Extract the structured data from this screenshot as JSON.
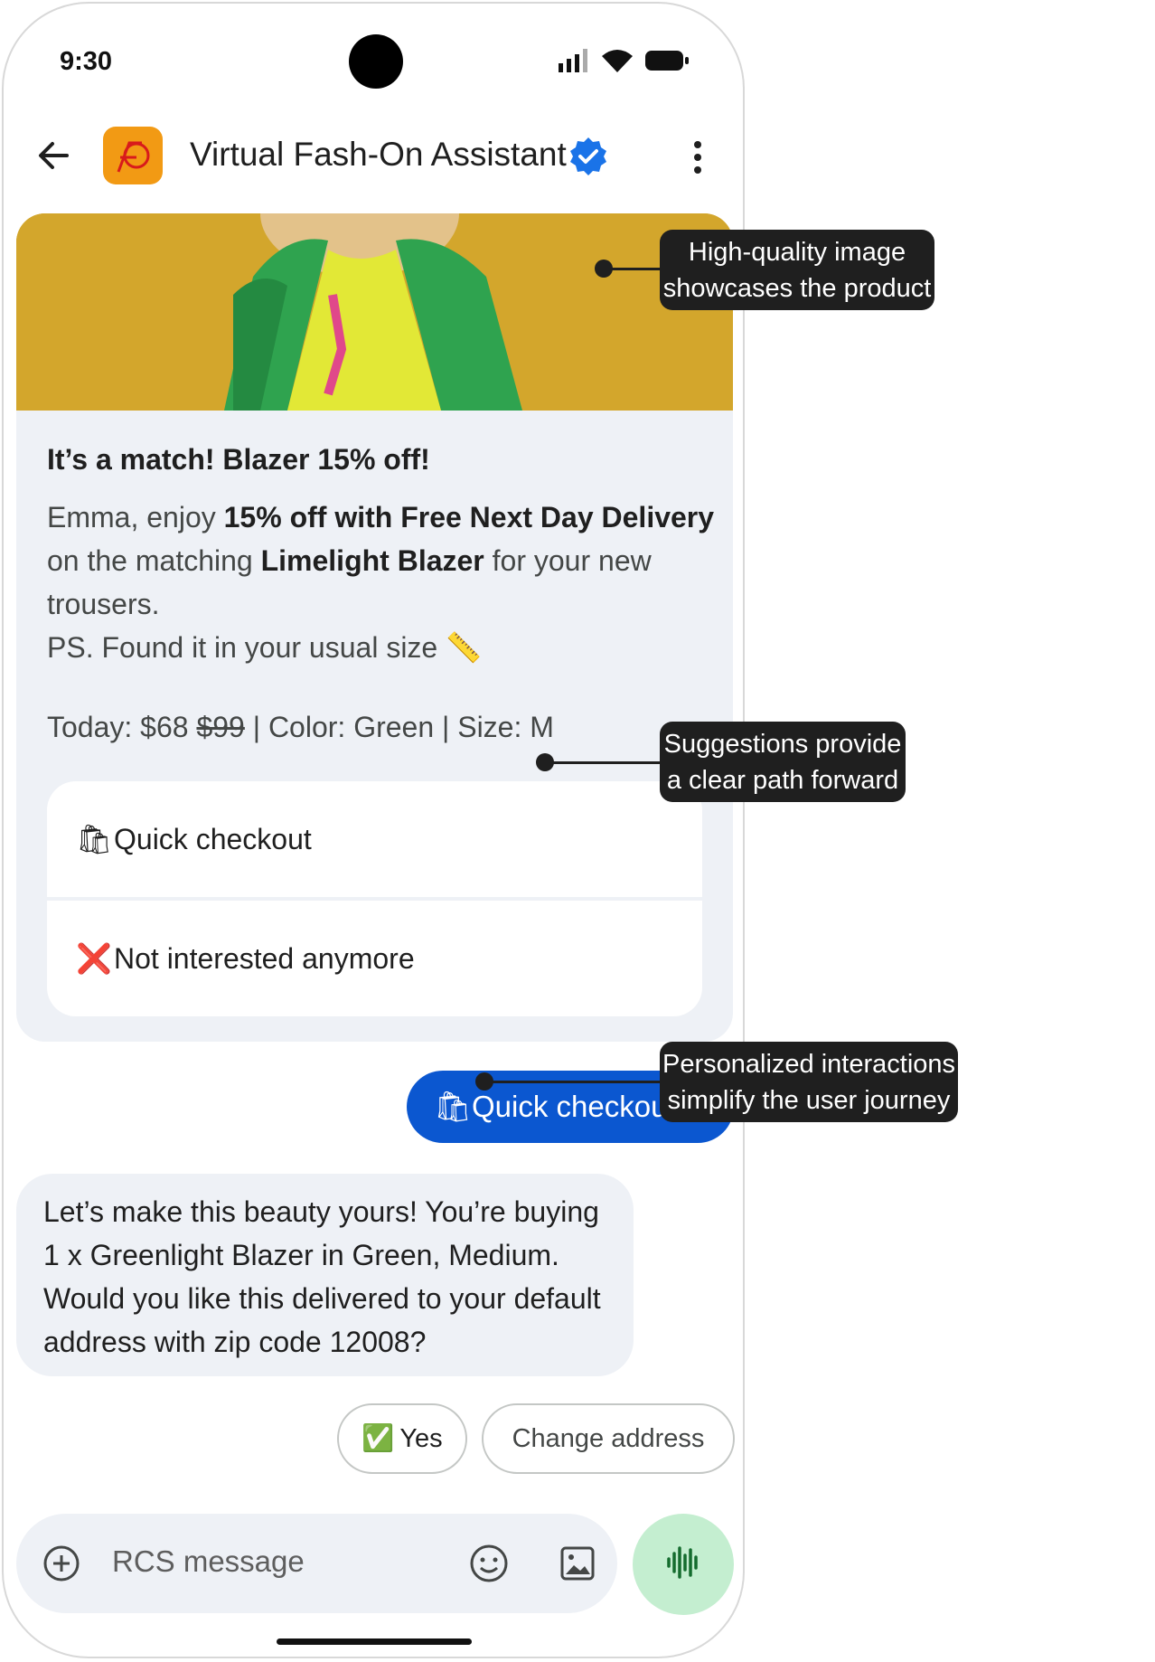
{
  "status_bar": {
    "time": "9:30"
  },
  "header": {
    "title": "Virtual Fash-On Assistant"
  },
  "card": {
    "title": "It’s a match! Blazer 15% off!",
    "body_1": "Emma, enjoy ",
    "body_bold_1": "15% off with Free Next Day Delivery",
    "body_2": " on the matching ",
    "body_bold_2": "Limelight Blazer",
    "body_3": " for your new trousers.",
    "body_4": "PS. Found it in your usual size 📏",
    "price_prefix": "Today: $68 ",
    "price_old": "$99",
    "price_suffix": " | Color: Green | Size: M",
    "suggestions": [
      {
        "emoji": "🛍",
        "label": "Quick checkout"
      },
      {
        "emoji": "❌",
        "label": "Not interested anymore"
      }
    ]
  },
  "sent_message": {
    "emoji": "🛍",
    "label": "Quick checkout"
  },
  "reply_message": {
    "text": "Let’s make this beauty yours! You’re buying 1 x Greenlight Blazer in Green, Medium. Would you like this delivered to your default address with zip code 12008?"
  },
  "reply_chips": [
    {
      "emoji": "✅",
      "label": "Yes"
    },
    {
      "label": "Change address"
    }
  ],
  "composer": {
    "placeholder": "RCS message"
  },
  "annotations": [
    {
      "line_1": "High-quality image",
      "line_2": "showcases the product"
    },
    {
      "line_1": "Suggestions provide",
      "line_2": "a clear path forward"
    },
    {
      "line_1": "Personalized interactions",
      "line_2": "simplify the user journey"
    }
  ],
  "colors": {
    "accent": "#0b57d0",
    "brand": "#f29a14",
    "card_bg": "#eef1f6",
    "voice_bg": "#c4eed0",
    "annotation_bg": "#1f1f1f"
  }
}
